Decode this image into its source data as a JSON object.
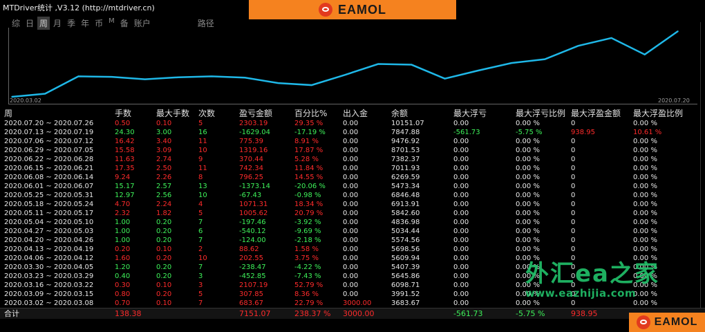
{
  "window": {
    "title": "MTDriver统计 ,V3.12 (http://mtdriver.cn)"
  },
  "brand": {
    "name": "EAMOL",
    "icon": "eamol-logo-icon"
  },
  "tabs": [
    {
      "label": "综"
    },
    {
      "label": "日"
    },
    {
      "label": "周",
      "active": true
    },
    {
      "label": "月"
    },
    {
      "label": "季"
    },
    {
      "label": "年"
    },
    {
      "label": "币"
    },
    {
      "label": "M"
    },
    {
      "label": "备"
    },
    {
      "label": "账户"
    },
    {
      "label": "路径"
    }
  ],
  "chart": {
    "start_label": "2020.03.02",
    "end_label": "2020.07.20",
    "line_color": "#1fb8e8"
  },
  "chart_data": {
    "type": "line",
    "title": "",
    "xlabel": "",
    "ylabel": "",
    "x": [
      "2020.03.02",
      "2020.03.09",
      "2020.03.16",
      "2020.03.23",
      "2020.03.30",
      "2020.04.06",
      "2020.04.13",
      "2020.04.20",
      "2020.04.27",
      "2020.05.04",
      "2020.05.11",
      "2020.05.18",
      "2020.05.25",
      "2020.06.01",
      "2020.06.08",
      "2020.06.15",
      "2020.06.22",
      "2020.06.29",
      "2020.07.06",
      "2020.07.13",
      "2020.07.20"
    ],
    "series": [
      {
        "values": [
          3683.67,
          3991.52,
          5698.74,
          5645.86,
          5407.39,
          5609.94,
          5698.56,
          5574.56,
          5034.44,
          4836.98,
          5842.6,
          6913.91,
          6846.48,
          5473.34,
          6269.59,
          7011.93,
          7382.37,
          8701.53,
          9476.92,
          7847.88,
          10151.07
        ]
      }
    ],
    "grid": false,
    "legend": "none"
  },
  "table": {
    "headers": [
      "周",
      "手数",
      "最大手数",
      "次数",
      "盈亏金额",
      "百分比%",
      "出入金",
      "余额",
      "最大浮亏",
      "最大浮亏比例",
      "最大浮盈金额",
      "最大浮盈比例"
    ],
    "rows": [
      [
        "2020.07.20 ~ 2020.07.26",
        "0.50",
        "0.10",
        "5",
        "2303.19",
        "29.35 %",
        "0.00",
        "10151.07",
        "0.00",
        "0.00 %",
        "0",
        "0.00 %"
      ],
      [
        "2020.07.13 ~ 2020.07.19",
        "24.30",
        "3.00",
        "16",
        "-1629.04",
        "-17.19 %",
        "0.00",
        "7847.88",
        "-561.73",
        "-5.75 %",
        "938.95",
        "10.61 %"
      ],
      [
        "2020.07.06 ~ 2020.07.12",
        "16.42",
        "3.40",
        "11",
        "775.39",
        "8.91 %",
        "0.00",
        "9476.92",
        "0.00",
        "0.00 %",
        "0",
        "0.00 %"
      ],
      [
        "2020.06.29 ~ 2020.07.05",
        "15.58",
        "3.09",
        "10",
        "1319.16",
        "17.87 %",
        "0.00",
        "8701.53",
        "0.00",
        "0.00 %",
        "0",
        "0.00 %"
      ],
      [
        "2020.06.22 ~ 2020.06.28",
        "11.63",
        "2.74",
        "9",
        "370.44",
        "5.28 %",
        "0.00",
        "7382.37",
        "0.00",
        "0.00 %",
        "0",
        "0.00 %"
      ],
      [
        "2020.06.15 ~ 2020.06.21",
        "17.35",
        "2.50",
        "11",
        "742.34",
        "11.84 %",
        "0.00",
        "7011.93",
        "0.00",
        "0.00 %",
        "0",
        "0.00 %"
      ],
      [
        "2020.06.08 ~ 2020.06.14",
        "9.24",
        "2.26",
        "8",
        "796.25",
        "14.55 %",
        "0.00",
        "6269.59",
        "0.00",
        "0.00 %",
        "0",
        "0.00 %"
      ],
      [
        "2020.06.01 ~ 2020.06.07",
        "15.17",
        "2.57",
        "13",
        "-1373.14",
        "-20.06 %",
        "0.00",
        "5473.34",
        "0.00",
        "0.00 %",
        "0",
        "0.00 %"
      ],
      [
        "2020.05.25 ~ 2020.05.31",
        "12.97",
        "2.56",
        "10",
        "-67.43",
        "-0.98 %",
        "0.00",
        "6846.48",
        "0.00",
        "0.00 %",
        "0",
        "0.00 %"
      ],
      [
        "2020.05.18 ~ 2020.05.24",
        "4.70",
        "2.24",
        "4",
        "1071.31",
        "18.34 %",
        "0.00",
        "6913.91",
        "0.00",
        "0.00 %",
        "0",
        "0.00 %"
      ],
      [
        "2020.05.11 ~ 2020.05.17",
        "2.32",
        "1.82",
        "5",
        "1005.62",
        "20.79 %",
        "0.00",
        "5842.60",
        "0.00",
        "0.00 %",
        "0",
        "0.00 %"
      ],
      [
        "2020.05.04 ~ 2020.05.10",
        "1.00",
        "0.20",
        "7",
        "-197.46",
        "-3.92 %",
        "0.00",
        "4836.98",
        "0.00",
        "0.00 %",
        "0",
        "0.00 %"
      ],
      [
        "2020.04.27 ~ 2020.05.03",
        "1.00",
        "0.20",
        "6",
        "-540.12",
        "-9.69 %",
        "0.00",
        "5034.44",
        "0.00",
        "0.00 %",
        "0",
        "0.00 %"
      ],
      [
        "2020.04.20 ~ 2020.04.26",
        "1.00",
        "0.20",
        "7",
        "-124.00",
        "-2.18 %",
        "0.00",
        "5574.56",
        "0.00",
        "0.00 %",
        "0",
        "0.00 %"
      ],
      [
        "2020.04.13 ~ 2020.04.19",
        "0.20",
        "0.10",
        "2",
        "88.62",
        "1.58 %",
        "0.00",
        "5698.56",
        "0.00",
        "0.00 %",
        "0",
        "0.00 %"
      ],
      [
        "2020.04.06 ~ 2020.04.12",
        "1.60",
        "0.20",
        "10",
        "202.55",
        "3.75 %",
        "0.00",
        "5609.94",
        "0.00",
        "0.00 %",
        "0",
        "0.00 %"
      ],
      [
        "2020.03.30 ~ 2020.04.05",
        "1.20",
        "0.20",
        "7",
        "-238.47",
        "-4.22 %",
        "0.00",
        "5407.39",
        "0.00",
        "0.00 %",
        "0",
        "0.00 %"
      ],
      [
        "2020.03.23 ~ 2020.03.29",
        "0.40",
        "0.20",
        "3",
        "-452.85",
        "-7.43 %",
        "0.00",
        "5645.86",
        "0.00",
        "0.00 %",
        "0",
        "0.00 %"
      ],
      [
        "2020.03.16 ~ 2020.03.22",
        "0.30",
        "0.10",
        "3",
        "2107.19",
        "52.79 %",
        "0.00",
        "6098.71",
        "0.00",
        "0.00 %",
        "0",
        "0.00 %"
      ],
      [
        "2020.03.09 ~ 2020.03.15",
        "0.80",
        "0.20",
        "5",
        "307.85",
        "8.36 %",
        "0.00",
        "3991.52",
        "0.00",
        "0.00 %",
        "0",
        "0.00 %"
      ],
      [
        "2020.03.02 ~ 2020.03.08",
        "0.70",
        "0.10",
        "7",
        "683.67",
        "22.79 %",
        "3000.00",
        "3683.67",
        "0.00",
        "0.00 %",
        "0",
        "0.00 %"
      ]
    ],
    "total": {
      "label": "合计",
      "lots": "138.38",
      "pnl": "7151.07",
      "pct": "238.37 %",
      "deposit": "3000.00",
      "max_dd": "-561.73",
      "max_dd_pct": "-5.75 %",
      "max_profit": "938.95"
    }
  },
  "watermark": {
    "line1": "外汇ea之家",
    "line2": "www.eazhijia.com"
  },
  "colors": {
    "positive": "#ff2b2b",
    "negative": "#3ef25a",
    "brand": "#f5821f"
  }
}
